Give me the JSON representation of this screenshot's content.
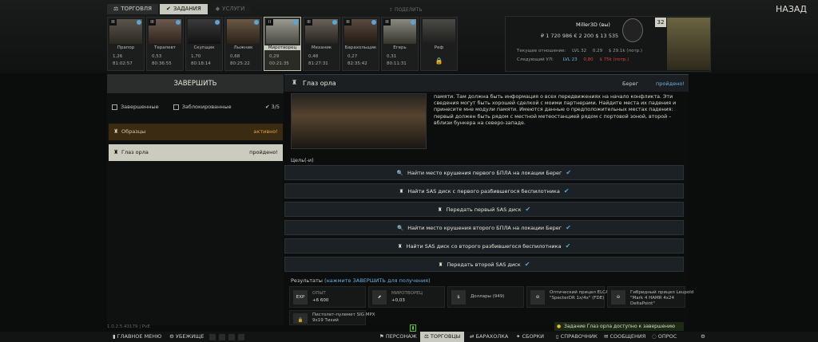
{
  "tabs": [
    "ТОРГОВЛЯ",
    "ЗАДАНИЯ",
    "УСЛУГИ"
  ],
  "share": "ПОДЕЛИТЬ",
  "back": "НАЗАД",
  "traders": [
    {
      "name": "Прапор",
      "lvl": "III",
      "rep": "1,26",
      "money": "81:02:57"
    },
    {
      "name": "Терапевт",
      "lvl": "III",
      "rep": "0,53",
      "money": "80:36:55"
    },
    {
      "name": "Скупщик",
      "lvl": "",
      "rep": "1,70",
      "money": "80:18:14"
    },
    {
      "name": "Лыжник",
      "lvl": "",
      "rep": "0,68",
      "money": "80:25:22"
    },
    {
      "name": "Миротворец",
      "lvl": "II",
      "rep": "0,29",
      "money": "00:21:35"
    },
    {
      "name": "Механик",
      "lvl": "III",
      "rep": "0,48",
      "money": "81:27:31"
    },
    {
      "name": "Барахольщик",
      "lvl": "III",
      "rep": "0,27",
      "money": "82:35:42"
    },
    {
      "name": "Егерь",
      "lvl": "III",
      "rep": "0,31",
      "money": "80:11:31"
    },
    {
      "name": "Реф",
      "lvl": "",
      "rep": "",
      "money": ""
    }
  ],
  "player": {
    "name": "Miller3D (вы)",
    "money": "₽ 1 720 986   € 2 200   $ 13 535",
    "cur_label": "Текущее отношение:",
    "cur_lvl": "LVL 32",
    "cur_rep": "0,29",
    "cur_money": "$ 29.1k (потр.)",
    "next_label": "Следующий УЛ:",
    "next_lvl": "LVL 23",
    "next_rep": "0,80",
    "next_money": "$ 75k (потр.)",
    "level": "32"
  },
  "left": {
    "finish": "ЗАВЕРШИТЬ",
    "completed": "Завершенные",
    "blocked": "Заблокированные",
    "count": "3/5",
    "quests": [
      {
        "name": "Образцы",
        "status": "активно!"
      },
      {
        "name": "Глаз орла",
        "status": "пройдено!"
      }
    ]
  },
  "quest": {
    "title": "Глаз орла",
    "location": "Берег",
    "status": "пройдено!",
    "desc": "памяти. Там должна быть информация о всех передвижениях на начало конфликта. Эти сведения могут быть хорошей сделкой с моими партнерами. Найдите места их падения и принесите мне модули памяти. Имеются данные о предположительных местах падения: первый должен быть рядом с местной метеостанцией рядом с портовой зоной, второй – вблизи бункера на северо-западе.",
    "obj_title": "Цель(-и)",
    "objectives": [
      "Найти место крушения первого БПЛА на локации Берег",
      "Найти SAS диск с первого разбившегося беспилотника",
      "Передать первый SAS диск",
      "Найти место крушения второго БПЛА на локации Берег",
      "Найти SAS диск со второго разбившегося беспилотника",
      "Передать второй SAS диск"
    ],
    "rewards_title": "Результаты",
    "rewards_hint": "(нажмите ЗАВЕРШИТЬ для получения)",
    "rewards": [
      {
        "icon": "EXP",
        "l1": "ОПЫТ",
        "l2": "+6 600"
      },
      {
        "icon": "",
        "l1": "МИРОТВОРЕЦ",
        "l2": "+0,03"
      },
      {
        "icon": "",
        "text": "Доллары (949)"
      },
      {
        "icon": "",
        "text": "Оптический прицел ELCAN \"SpecterDR 1x/4x\" (FDE)"
      },
      {
        "icon": "",
        "text": "Гибридный прицел Leupold \"Mark 4 HAMR 4x24 DeltaPoint\""
      },
      {
        "icon": "",
        "text": "Пистолет-пулемет SIG MPX 9x19 Тихий"
      }
    ]
  },
  "version": "1.0.2.5.43179 | PvE",
  "toast": "Задание Глаз орла доступно к завершению",
  "bottom": {
    "main": "ГЛАВНОЕ МЕНЮ",
    "hideout": "УБЕЖИЩЕ",
    "character": "ПЕРСОНАЖ",
    "traders": "ТОРГОВЦЫ",
    "flea": "БАРАХОЛКА",
    "builds": "СБОРКИ",
    "handbook": "СПРАВОЧНИК",
    "messages": "СООБЩЕНИЯ",
    "survey": "ОПРОС"
  }
}
